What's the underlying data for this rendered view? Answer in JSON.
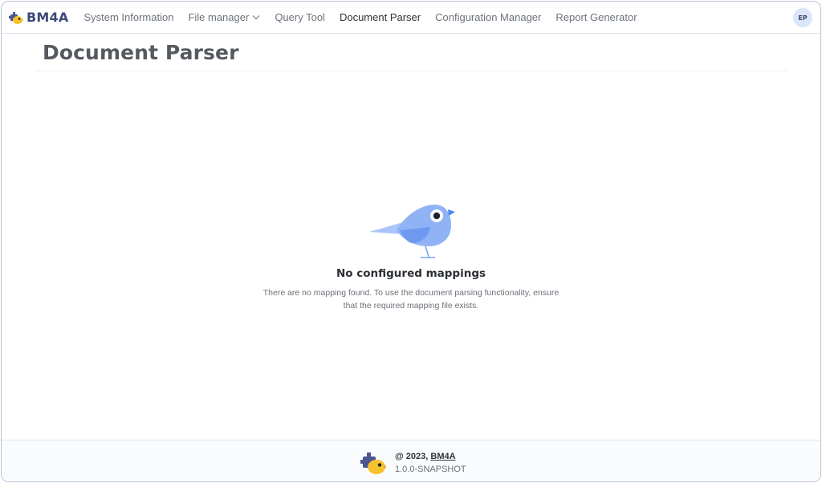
{
  "brand": {
    "name": "BM4A"
  },
  "nav": {
    "items": [
      {
        "label": "System Information"
      },
      {
        "label": "File manager"
      },
      {
        "label": "Query Tool"
      },
      {
        "label": "Document Parser"
      },
      {
        "label": "Configuration Manager"
      },
      {
        "label": "Report Generator"
      }
    ],
    "active": "Document Parser"
  },
  "user": {
    "initials": "EP"
  },
  "page": {
    "title": "Document Parser"
  },
  "empty_state": {
    "illustration": "bird-icon",
    "title": "No configured mappings",
    "description": "There are no mapping found. To use the document parsing functionality, ensure that the required mapping file exists."
  },
  "footer": {
    "copyright_prefix": "@ 2023, ",
    "copyright_link": "BM4A",
    "version": "1.0.0-SNAPSHOT"
  },
  "colors": {
    "brand_text": "#3d4a78",
    "bird_body": "#8fb3f5",
    "bird_wing": "#6d9af0",
    "avatar_bg": "#dbe6fb"
  }
}
